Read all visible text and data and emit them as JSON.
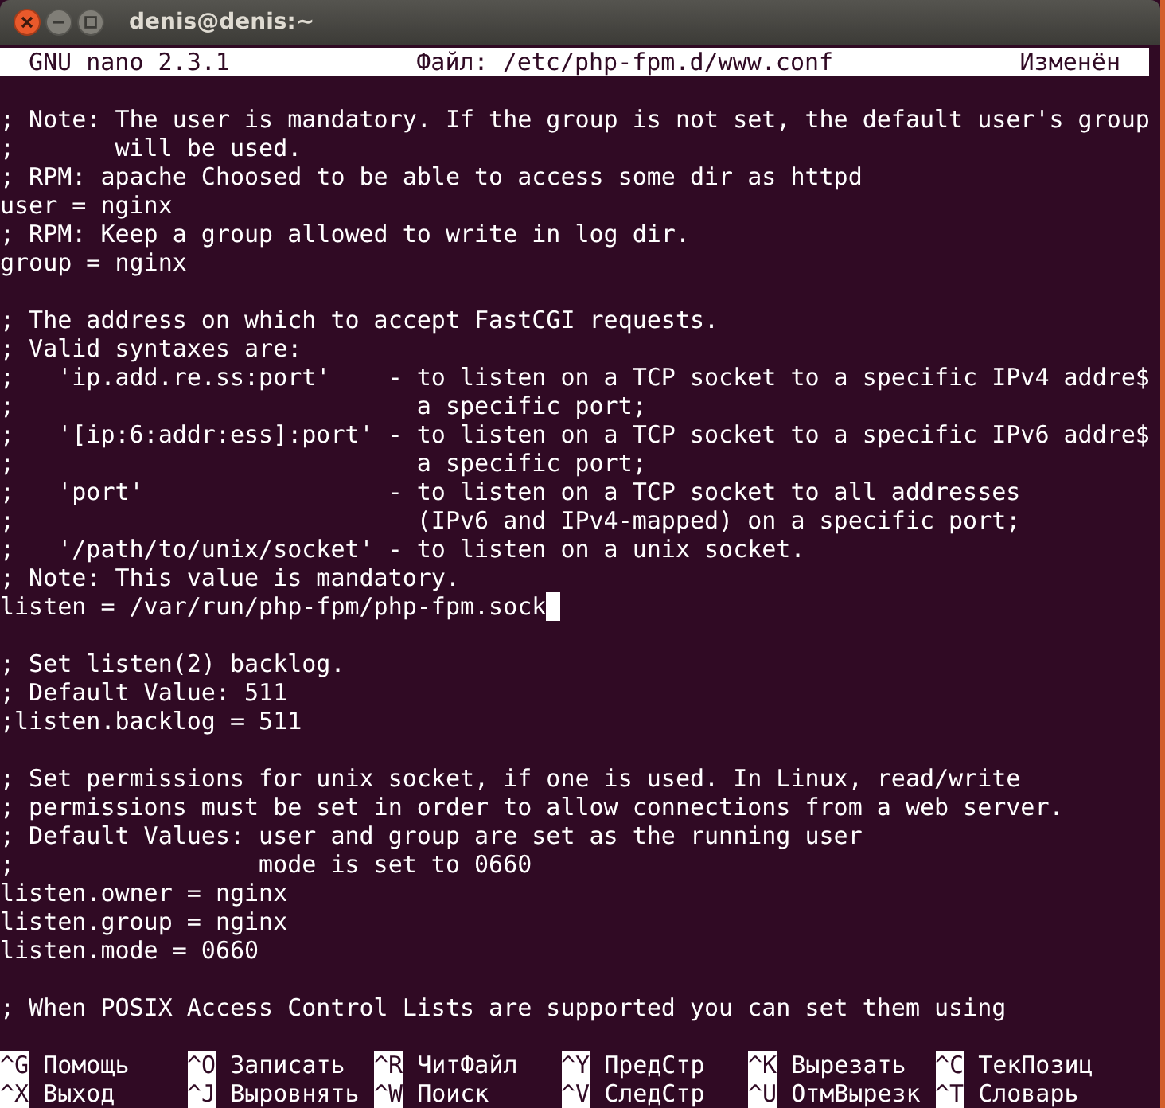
{
  "window": {
    "title": "denis@denis:~"
  },
  "header": {
    "program": "GNU nano 2.3.1",
    "file": "Файл: /etc/php-fpm.d/www.conf",
    "status": "Изменён"
  },
  "blocks": [
    {
      "lines": [
        {
          "text": "; Note: The user is mandatory. If the group is not set, the default user's group",
          "cursor": false
        },
        {
          "text": ";       will be used.",
          "cursor": false
        },
        {
          "text": "; RPM: apache Choosed to be able to access some dir as httpd",
          "cursor": false
        },
        {
          "text": "user = nginx",
          "cursor": false
        },
        {
          "text": "; RPM: Keep a group allowed to write in log dir.",
          "cursor": false
        },
        {
          "text": "group = nginx",
          "cursor": false
        }
      ]
    },
    {
      "lines": [
        {
          "text": "; The address on which to accept FastCGI requests.",
          "cursor": false
        },
        {
          "text": "; Valid syntaxes are:",
          "cursor": false
        },
        {
          "text": ";   'ip.add.re.ss:port'    - to listen on a TCP socket to a specific IPv4 addre$",
          "cursor": false
        },
        {
          "text": ";                            a specific port;",
          "cursor": false
        },
        {
          "text": ";   '[ip:6:addr:ess]:port' - to listen on a TCP socket to a specific IPv6 addre$",
          "cursor": false
        },
        {
          "text": ";                            a specific port;",
          "cursor": false
        },
        {
          "text": ";   'port'                 - to listen on a TCP socket to all addresses",
          "cursor": false
        },
        {
          "text": ";                            (IPv6 and IPv4-mapped) on a specific port;",
          "cursor": false
        },
        {
          "text": ";   '/path/to/unix/socket' - to listen on a unix socket.",
          "cursor": false
        },
        {
          "text": "; Note: This value is mandatory.",
          "cursor": false
        },
        {
          "text": "listen = /var/run/php-fpm/php-fpm.sock",
          "cursor": true
        }
      ]
    },
    {
      "lines": [
        {
          "text": "; Set listen(2) backlog.",
          "cursor": false
        },
        {
          "text": "; Default Value: 511",
          "cursor": false
        },
        {
          "text": ";listen.backlog = 511",
          "cursor": false
        }
      ]
    },
    {
      "lines": [
        {
          "text": "; Set permissions for unix socket, if one is used. In Linux, read/write",
          "cursor": false
        },
        {
          "text": "; permissions must be set in order to allow connections from a web server.",
          "cursor": false
        },
        {
          "text": "; Default Values: user and group are set as the running user",
          "cursor": false
        },
        {
          "text": ";                 mode is set to 0660",
          "cursor": false
        },
        {
          "text": "listen.owner = nginx",
          "cursor": false
        },
        {
          "text": "listen.group = nginx",
          "cursor": false
        },
        {
          "text": "listen.mode = 0660",
          "cursor": false
        }
      ]
    },
    {
      "lines": [
        {
          "text": "; When POSIX Access Control Lists are supported you can set them using",
          "cursor": false
        }
      ]
    }
  ],
  "shortcuts": [
    {
      "key": "^G",
      "label": "Помощь"
    },
    {
      "key": "^O",
      "label": "Записать"
    },
    {
      "key": "^R",
      "label": "ЧитФайл"
    },
    {
      "key": "^Y",
      "label": "ПредСтр"
    },
    {
      "key": "^K",
      "label": "Вырезать"
    },
    {
      "key": "^C",
      "label": "ТекПозиц"
    },
    {
      "key": "^X",
      "label": "Выход"
    },
    {
      "key": "^J",
      "label": "Выровнять"
    },
    {
      "key": "^W",
      "label": "Поиск"
    },
    {
      "key": "^V",
      "label": "СледСтр"
    },
    {
      "key": "^U",
      "label": "ОтмВырезк"
    },
    {
      "key": "^T",
      "label": "Словарь"
    }
  ]
}
